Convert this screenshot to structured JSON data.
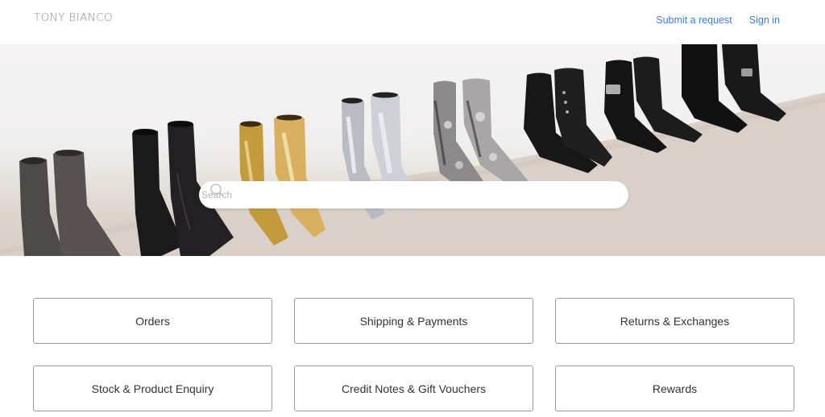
{
  "header": {
    "logo": "TONY BIANCO",
    "nav": [
      {
        "label": "Submit a request"
      },
      {
        "label": "Sign in"
      }
    ],
    "link_color": "#3a7ddc"
  },
  "hero": {
    "image_description": "Row of ankle boots against a white wall on a concrete floor: grey suede, black leather, gold metallic, silver metallic, snakeskin, black lace-up, black buckle, black biker boots",
    "search": {
      "icon": "search-icon",
      "placeholder": "Search",
      "value": ""
    }
  },
  "categories": [
    {
      "label": "Orders"
    },
    {
      "label": "Shipping & Payments"
    },
    {
      "label": "Returns & Exchanges"
    },
    {
      "label": "Stock & Product Enquiry"
    },
    {
      "label": "Credit Notes & Gift Vouchers"
    },
    {
      "label": "Rewards"
    }
  ]
}
